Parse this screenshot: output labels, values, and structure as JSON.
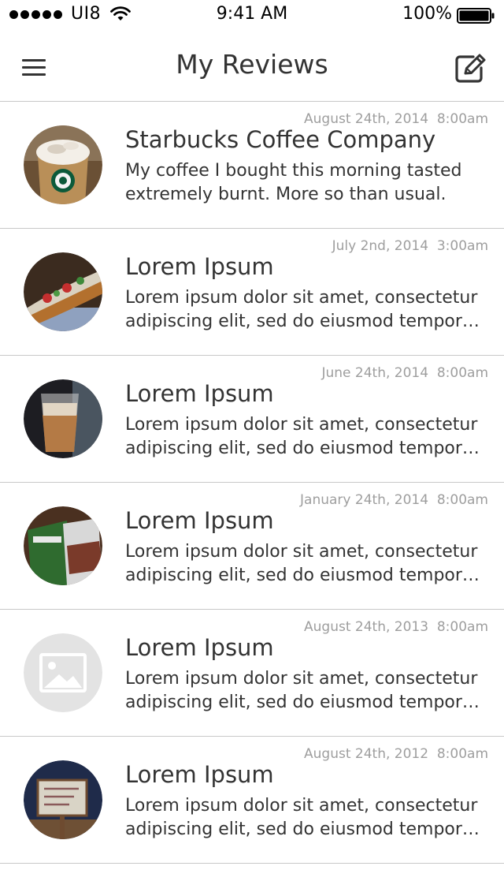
{
  "status_bar": {
    "carrier": "UI8",
    "time": "9:41 AM",
    "battery": "100%"
  },
  "nav": {
    "title": "My Reviews",
    "left_icon": "menu-icon",
    "right_icon": "compose-icon"
  },
  "reviews": [
    {
      "date": "August 24th, 2014  8:00am",
      "name": "Starbucks Coffee Company",
      "text": "My coffee I bought this morning tasted extremely burnt. More so than usual.",
      "thumb": "starbucks-coffee"
    },
    {
      "date": "July 2nd, 2014  3:00am",
      "name": "Lorem Ipsum",
      "text": "Lorem ipsum dolor sit amet, consectetur adipiscing elit, sed do eiusmod tempor…",
      "thumb": "hotdog-food"
    },
    {
      "date": "June 24th, 2014  8:00am",
      "name": "Lorem Ipsum",
      "text": "Lorem ipsum dolor sit amet, consectetur adipiscing elit, sed do eiusmod tempor…",
      "thumb": "iced-drink"
    },
    {
      "date": "January 24th, 2014  8:00am",
      "name": "Lorem Ipsum",
      "text": "Lorem ipsum dolor sit amet, consectetur adipiscing elit, sed do eiusmod tempor…",
      "thumb": "game-boxes"
    },
    {
      "date": "August 24th, 2013  8:00am",
      "name": "Lorem Ipsum",
      "text": "Lorem ipsum dolor sit amet, consectetur adipiscing elit, sed do eiusmod tempor…",
      "thumb": "image-placeholder-icon"
    },
    {
      "date": "August 24th, 2012  8:00am",
      "name": "Lorem Ipsum",
      "text": "Lorem ipsum dolor sit amet, consectetur adipiscing elit, sed do eiusmod tempor…",
      "thumb": "street-sign"
    }
  ]
}
